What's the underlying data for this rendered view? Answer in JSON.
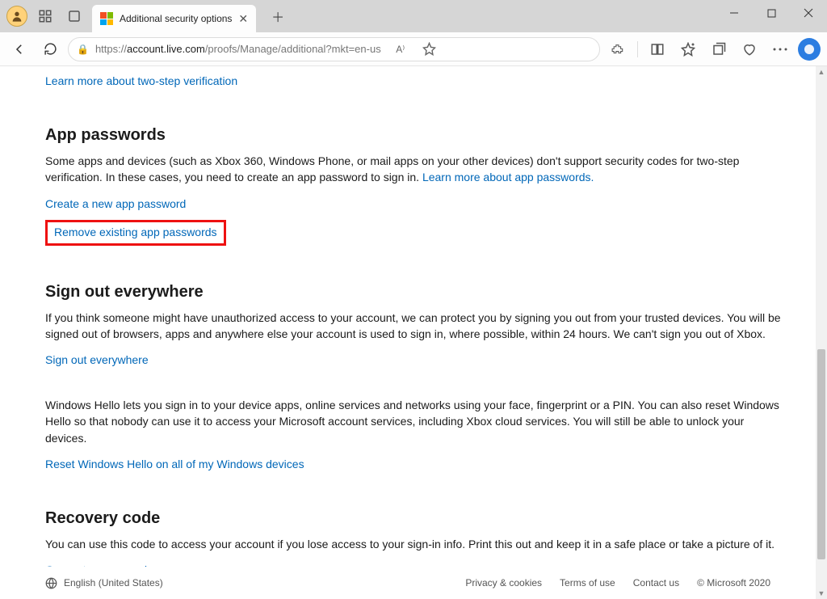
{
  "window": {
    "tab_title": "Additional security options",
    "url_prefix": "https://",
    "url_host": "account.live.com",
    "url_path": "/proofs/Manage/additional?mkt=en-us"
  },
  "top_link": "Learn more about two-step verification",
  "app_passwords": {
    "heading": "App passwords",
    "body_pre": "Some apps and devices (such as Xbox 360, Windows Phone, or mail apps on your other devices) don't support security codes for two-step verification. In these cases, you need to create an app password to sign in. ",
    "body_link": "Learn more about app passwords.",
    "create_link": "Create a new app password",
    "remove_link": "Remove existing app passwords"
  },
  "sign_out": {
    "heading": "Sign out everywhere",
    "body": "If you think someone might have unauthorized access to your account, we can protect you by signing you out from your trusted devices. You will be signed out of browsers, apps and anywhere else your account is used to sign in, where possible, within 24 hours. We can't sign you out of Xbox.",
    "link": "Sign out everywhere"
  },
  "windows_hello": {
    "body": "Windows Hello lets you sign in to your device apps, online services and networks using your face, fingerprint or a PIN. You can also reset Windows Hello so that nobody can use it to access your Microsoft account services, including Xbox cloud services. You will still be able to unlock your devices.",
    "link": "Reset Windows Hello on all of my Windows devices"
  },
  "recovery": {
    "heading": "Recovery code",
    "body": "You can use this code to access your account if you lose access to your sign-in info. Print this out and keep it in a safe place or take a picture of it.",
    "link": "Generate a new code"
  },
  "footer": {
    "language": "English (United States)",
    "privacy": "Privacy & cookies",
    "terms": "Terms of use",
    "contact": "Contact us",
    "copyright": "© Microsoft 2020"
  }
}
